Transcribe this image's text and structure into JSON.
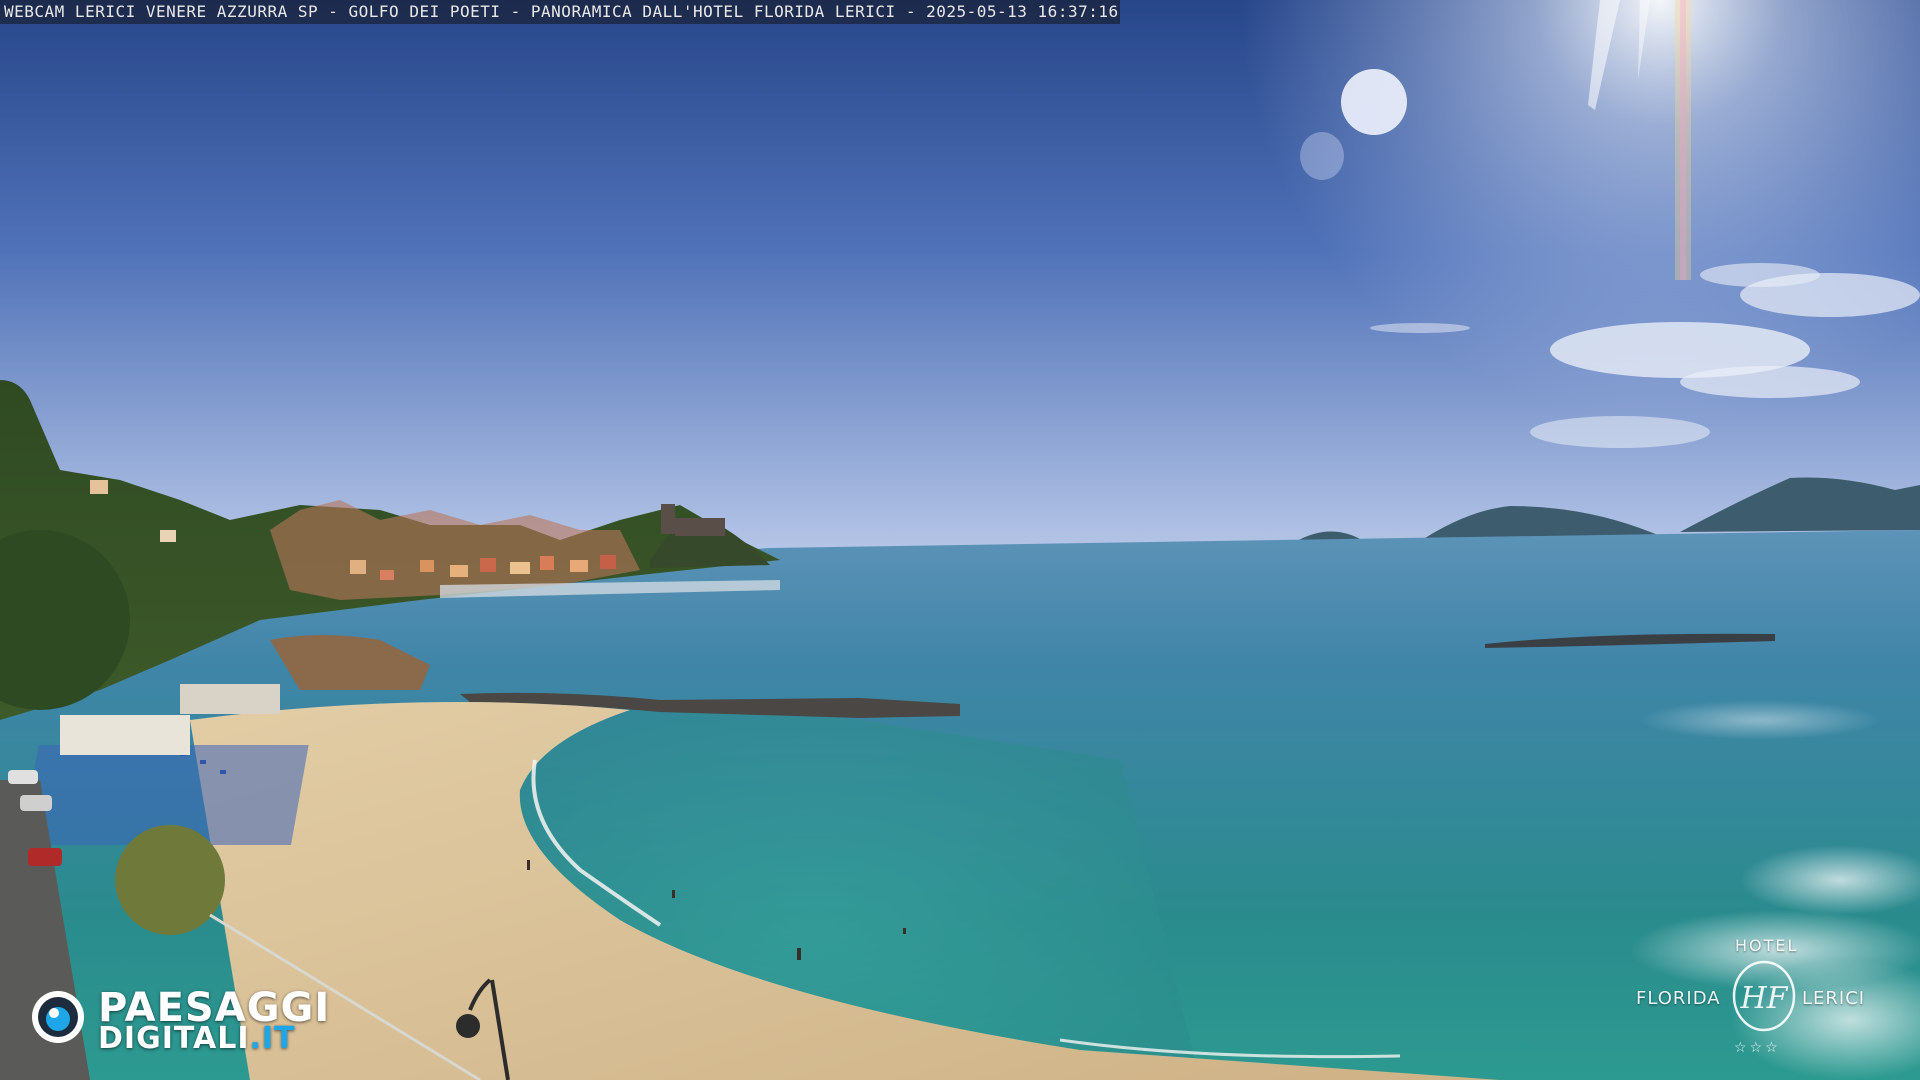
{
  "overlay": {
    "caption": "WEBCAM LERICI VENERE AZZURRA SP - GOLFO DEI POETI - PANORAMICA DALL'HOTEL FLORIDA LERICI - 2025-05-13 16:37:16"
  },
  "logo_paesaggi": {
    "line1": "PAESAGGI",
    "line2_main": "DIGITALI",
    "line2_tld": ".IT",
    "accent_color": "#1ea7e8"
  },
  "logo_hotel": {
    "top": "HOTEL",
    "left": "FLORIDA",
    "right": "LERICI",
    "monogram": "HF",
    "stars": "☆☆☆"
  },
  "scene": {
    "sky_top": "#2c4a8a",
    "sky_horizon": "#a9bfe6",
    "sea_far": "#4f8fb0",
    "sea_near": "#2f8e8a",
    "sand": "#dcc59b",
    "icons": [
      "sun-icon",
      "castle-icon",
      "umbrella-icon",
      "street-lamp-icon"
    ]
  }
}
